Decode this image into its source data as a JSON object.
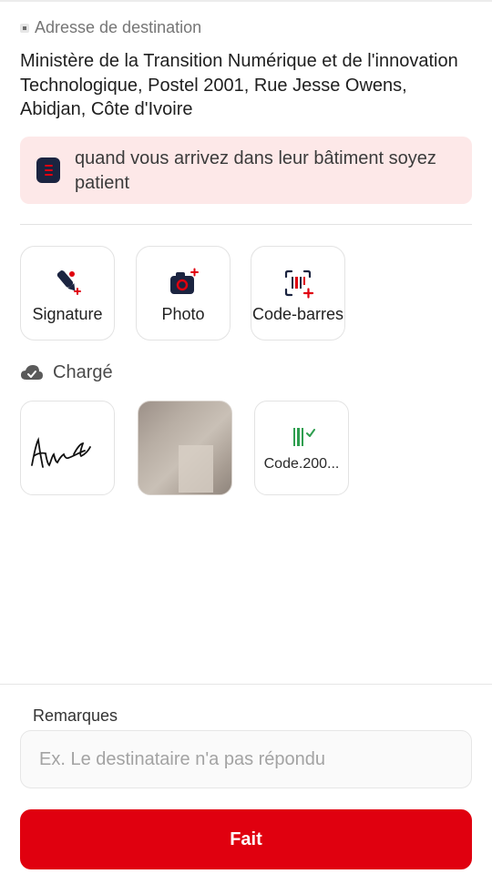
{
  "destination": {
    "label": "Adresse de destination",
    "address": "Ministère de la Transition Numérique et de l'innovation Technologique, Postel 2001, Rue Jesse Owens, Abidjan, Côte d'Ivoire"
  },
  "note": {
    "icon": "note-list-icon",
    "text": "quand vous arrivez dans leur bâtiment soyez patient"
  },
  "capture_options": [
    {
      "label": "Signature",
      "icon": "signature-pen-icon"
    },
    {
      "label": "Photo",
      "icon": "camera-add-icon"
    },
    {
      "label": "Code-barres",
      "icon": "barcode-scan-icon"
    }
  ],
  "uploaded": {
    "label": "Chargé",
    "icon": "cloud-check-icon",
    "items": [
      {
        "type": "signature"
      },
      {
        "type": "photo"
      },
      {
        "type": "barcode",
        "file_name": "Code.200..."
      }
    ]
  },
  "remarks": {
    "label": "Remarques",
    "placeholder": "Ex. Le destinataire n'a pas répondu",
    "value": ""
  },
  "submit": {
    "label": "Fait"
  },
  "colors": {
    "accent": "#e0000f",
    "note_bg": "#fde8e8",
    "navy": "#1b2440",
    "barcode_green": "#2e9e4f"
  }
}
